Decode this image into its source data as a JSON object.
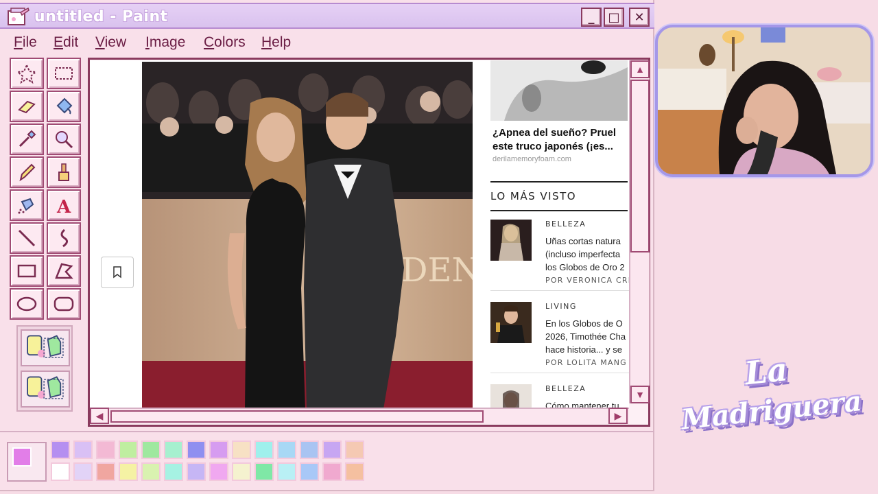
{
  "window": {
    "title": "untitled - Paint",
    "minimize": "_",
    "maximize": "□",
    "close": "✕"
  },
  "menu": [
    "File",
    "Edit",
    "View",
    "Image",
    "Colors",
    "Help"
  ],
  "tools": [
    "free-form-select",
    "rect-select",
    "eraser",
    "fill-bucket",
    "color-picker",
    "magnifier",
    "pencil",
    "brush",
    "airbrush",
    "text",
    "line",
    "curve",
    "rectangle",
    "polygon",
    "ellipse",
    "rounded-rectangle"
  ],
  "webpage": {
    "ad": {
      "title_line1": "¿Apnea del sueño? Pruel",
      "title_line2": "este truco japonés (¡es...",
      "source": "derilamemoryfoam.com"
    },
    "most_viewed_title": "LO MÁS VISTO",
    "articles": [
      {
        "category": "BELLEZA",
        "line1": "Uñas cortas natura",
        "line2": "(incluso imperfecta",
        "line3": "los Globos de Oro 2",
        "byline": "POR VERONICA CRIS"
      },
      {
        "category": "LIVING",
        "line1": "En los Globos de O",
        "line2": "2026, Timothée Cha",
        "line3": "hace historia... y se",
        "byline": "POR LOLITA MANG"
      },
      {
        "category": "BELLEZA",
        "line1": "Cómo mantener tu",
        "line2": "",
        "line3": "",
        "byline": ""
      }
    ],
    "photo_backdrop_text": "DEN"
  },
  "palette": {
    "foreground": "#e27ee8",
    "row1": [
      "#b58ff0",
      "#d9c0f5",
      "#f3b9d4",
      "#bfeea0",
      "#9fe89f",
      "#a6f0cf",
      "#8f8ff0",
      "#d69cf0",
      "#f7e1c4",
      "#9ff0ec",
      "#a8d8f5",
      "#a9c4f2",
      "#c7a6f2",
      "#f5c9b3"
    ],
    "row2": [
      "#ffffff",
      "#e2d3f7",
      "#f0a6a0",
      "#f5f2a4",
      "#d9f2b0",
      "#a6f2e3",
      "#c6b6f5",
      "#f0a8f0",
      "#f5f2cf",
      "#7fe8a6",
      "#b9f0f5",
      "#a8c8f7",
      "#f0a9cf",
      "#f5c0a0"
    ]
  },
  "overlay": {
    "logo_line1": "La",
    "logo_line2": "Madriguera"
  }
}
